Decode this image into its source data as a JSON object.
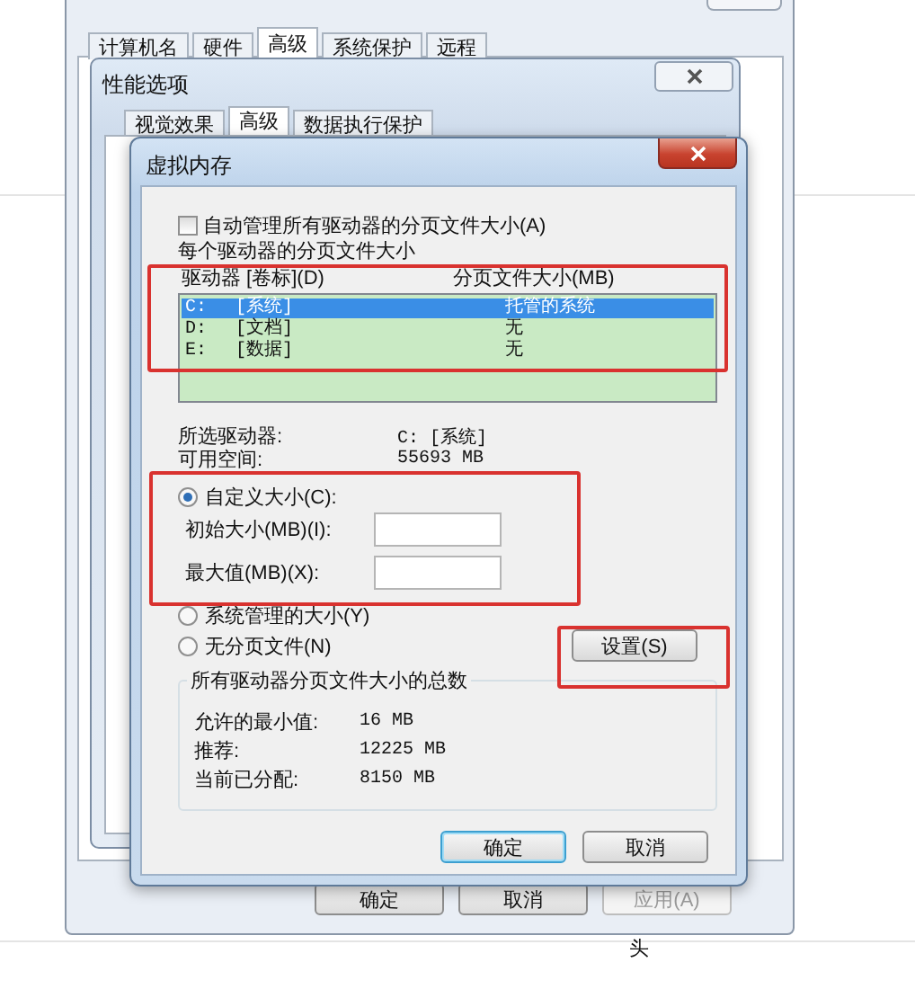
{
  "system_properties": {
    "tabs": [
      {
        "label": "计算机名",
        "selected": false
      },
      {
        "label": "硬件",
        "selected": false
      },
      {
        "label": "高级",
        "selected": true
      },
      {
        "label": "系统保护",
        "selected": false
      },
      {
        "label": "远程",
        "selected": false
      }
    ],
    "buttons": [
      {
        "label": "确定",
        "disabled": false
      },
      {
        "label": "取消",
        "disabled": false
      },
      {
        "label": "应用(A)",
        "disabled": true
      }
    ]
  },
  "performance_options": {
    "title": "性能选项",
    "tabs": [
      {
        "label": "视觉效果",
        "selected": false
      },
      {
        "label": "高级",
        "selected": true
      },
      {
        "label": "数据执行保护",
        "selected": false
      }
    ]
  },
  "virtual_memory": {
    "title": "虚拟内存",
    "auto_manage": {
      "label": "自动管理所有驱动器的分页文件大小(A)",
      "checked": false
    },
    "per_drive_label": "每个驱动器的分页文件大小",
    "columns": [
      "驱动器 [卷标](D)",
      "分页文件大小(MB)"
    ],
    "drives": [
      {
        "drive": "C:",
        "volume": "[系统]",
        "paging": "托管的系统",
        "selected": true
      },
      {
        "drive": "D:",
        "volume": "[文档]",
        "paging": "无",
        "selected": false
      },
      {
        "drive": "E:",
        "volume": "[数据]",
        "paging": "无",
        "selected": false
      }
    ],
    "selected_drive": {
      "label": "所选驱动器:",
      "value": "C:  [系统]"
    },
    "free_space": {
      "label": "可用空间:",
      "value": "55693 MB"
    },
    "size_options": [
      {
        "label": "自定义大小(C):",
        "selected": true
      },
      {
        "label": "系统管理的大小(Y)",
        "selected": false
      },
      {
        "label": "无分页文件(N)",
        "selected": false
      }
    ],
    "fields": [
      {
        "label": "初始大小(MB)(I):"
      },
      {
        "label": "最大值(MB)(X):"
      }
    ],
    "set_button": "设置(S)",
    "totals": {
      "title": "所有驱动器分页文件大小的总数",
      "rows": [
        {
          "label": "允许的最小值:",
          "value": "16 MB"
        },
        {
          "label": "推荐:",
          "value": "12225 MB"
        },
        {
          "label": "当前已分配:",
          "value": "8150 MB"
        }
      ]
    },
    "buttons": [
      {
        "label": "确定",
        "default": true
      },
      {
        "label": "取消",
        "default": false
      }
    ]
  },
  "highlights": [
    {
      "color": "#d9322f"
    },
    {
      "color": "#d9322f"
    },
    {
      "color": "#d9322f"
    }
  ],
  "footer_text": "头"
}
